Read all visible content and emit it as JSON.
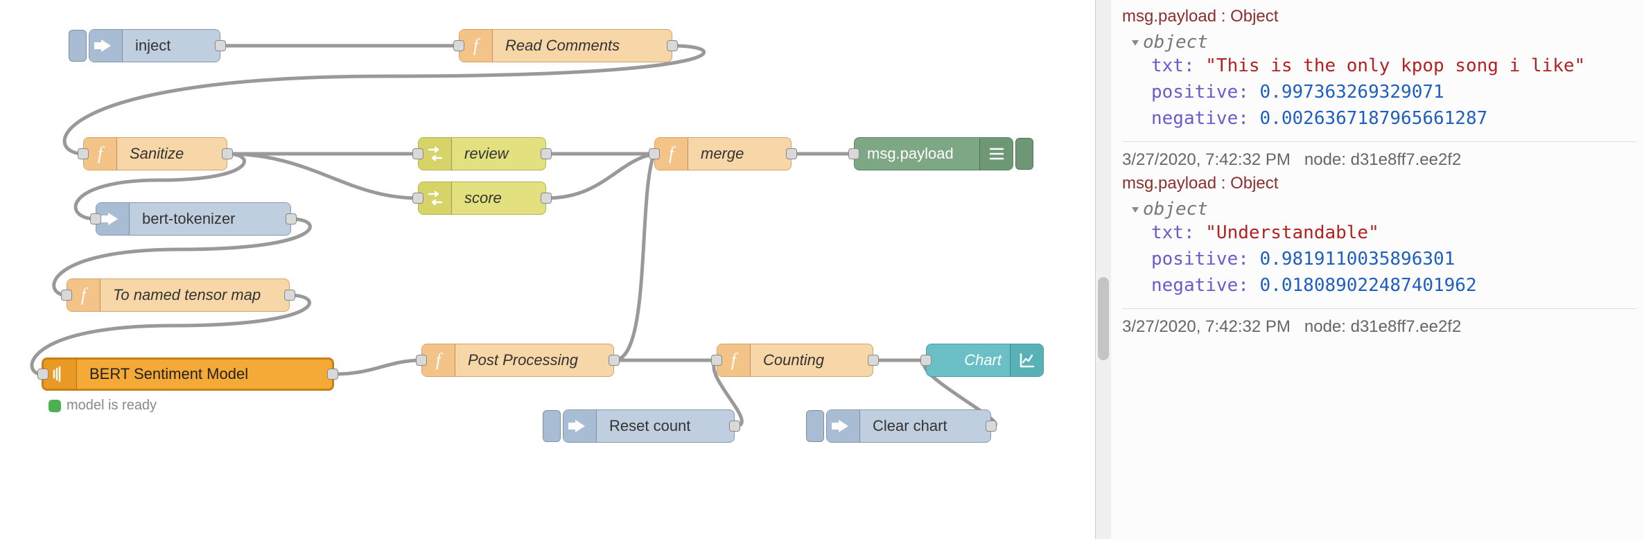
{
  "nodes": {
    "inject": "inject",
    "read_comments": "Read Comments",
    "sanitize": "Sanitize",
    "review": "review",
    "merge": "merge",
    "msg_payload": "msg.payload",
    "score": "score",
    "bert_tokenizer": "bert-tokenizer",
    "to_named_tensor": "To named tensor map",
    "bert_model": "BERT Sentiment Model",
    "post_processing": "Post Processing",
    "counting": "Counting",
    "chart": "Chart",
    "reset_count": "Reset count",
    "clear_chart": "Clear chart"
  },
  "status": {
    "bert_model": "model is ready"
  },
  "debug": {
    "messages": [
      {
        "meta_prefix": "",
        "meta_node": "",
        "topic": "msg.payload : Object",
        "object_label": "object",
        "fields": {
          "txt_key": "txt",
          "txt_val": "\"This is the only kpop song i like\"",
          "positive_key": "positive",
          "positive_val": "0.997363269329071",
          "negative_key": "negative",
          "negative_val": "0.0026367187965661287"
        }
      },
      {
        "meta_time": "3/27/2020, 7:42:32 PM",
        "meta_node": "node: d31e8ff7.ee2f2",
        "topic": "msg.payload : Object",
        "object_label": "object",
        "fields": {
          "txt_key": "txt",
          "txt_val": "\"Understandable\"",
          "positive_key": "positive",
          "positive_val": "0.9819110035896301",
          "negative_key": "negative",
          "negative_val": "0.018089022487401962"
        }
      },
      {
        "meta_time": "3/27/2020, 7:42:32 PM",
        "meta_node": "node: d31e8ff7.ee2f2"
      }
    ]
  }
}
